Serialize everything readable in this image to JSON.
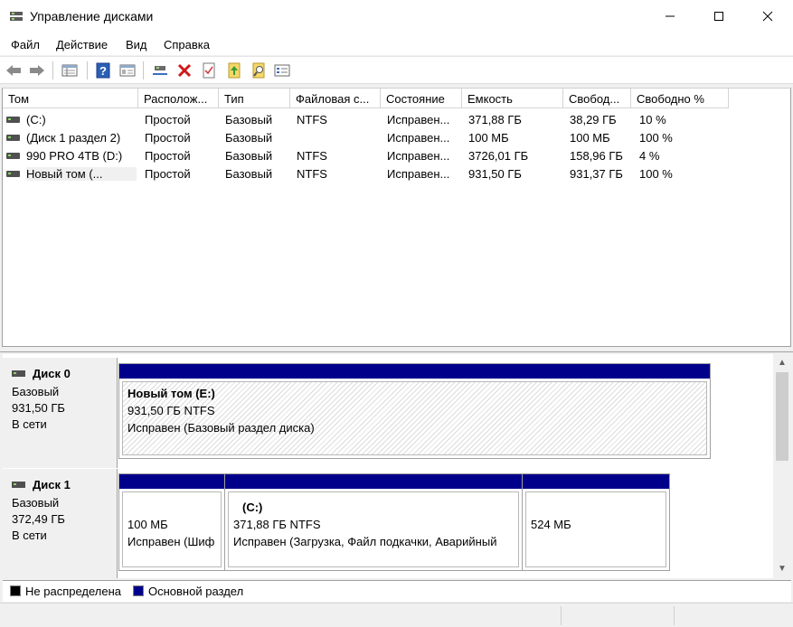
{
  "window": {
    "title": "Управление дисками"
  },
  "menu": [
    "Файл",
    "Действие",
    "Вид",
    "Справка"
  ],
  "toolbar": {
    "icons": [
      "back-arrow-icon",
      "forward-arrow-icon",
      "disk-list-icon",
      "help-icon",
      "properties-icon",
      "connect-icon",
      "delete-icon",
      "check-icon",
      "import-icon",
      "search-icon",
      "settings-list-icon"
    ]
  },
  "columns": [
    "Том",
    "Располож...",
    "Тип",
    "Файловая с...",
    "Состояние",
    "Емкость",
    "Свобод...",
    "Свободно %"
  ],
  "volumes": [
    [
      "(C:)",
      "Простой",
      "Базовый",
      "NTFS",
      "Исправен...",
      "371,88 ГБ",
      "38,29 ГБ",
      "10 %"
    ],
    [
      "(Диск 1 раздел 2)",
      "Простой",
      "Базовый",
      "",
      "Исправен...",
      "100 МБ",
      "100 МБ",
      "100 %"
    ],
    [
      "990 PRO 4TB (D:)",
      "Простой",
      "Базовый",
      "NTFS",
      "Исправен...",
      "3726,01 ГБ",
      "158,96 ГБ",
      "4 %"
    ],
    [
      "Новый том (...",
      "Простой",
      "Базовый",
      "NTFS",
      "Исправен...",
      "931,50 ГБ",
      "931,37 ГБ",
      "100 %"
    ]
  ],
  "disks": [
    {
      "name": "Диск 0",
      "type": "Базовый",
      "size": "931,50 ГБ",
      "status": "В сети",
      "partitions": [
        {
          "title": "Новый том  (E:)",
          "size": "931,50 ГБ NTFS",
          "status": "Исправен (Базовый раздел диска)"
        }
      ]
    },
    {
      "name": "Диск 1",
      "type": "Базовый",
      "size": "372,49 ГБ",
      "status": "В сети",
      "partitions": [
        {
          "title": "",
          "size": "100 МБ",
          "status": "Исправен (Шиф"
        },
        {
          "title": "(C:)",
          "size": "371,88 ГБ NTFS",
          "status": "Исправен (Загрузка, Файл подкачки, Аварийный"
        },
        {
          "title": "",
          "size": "524 МБ",
          "status": ""
        }
      ]
    }
  ],
  "legend": [
    {
      "label": "Не распределена",
      "color": "#000000"
    },
    {
      "label": "Основной раздел",
      "color": "#00008b"
    }
  ],
  "colors": {
    "primary_partition": "#00008b",
    "unallocated": "#000000"
  }
}
